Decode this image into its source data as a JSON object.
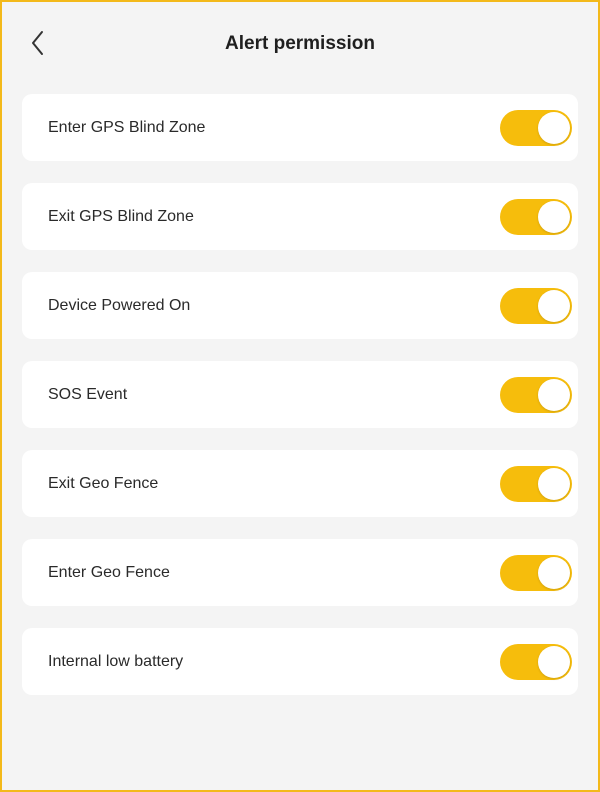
{
  "header": {
    "title": "Alert permission",
    "back_icon": "chevron-left-icon"
  },
  "colors": {
    "accent": "#f6bd0c",
    "frame_border": "#f3b91a",
    "background": "#f4f4f4",
    "card": "#ffffff"
  },
  "alerts": [
    {
      "label": "Enter GPS Blind Zone",
      "enabled": true
    },
    {
      "label": "Exit GPS Blind Zone",
      "enabled": true
    },
    {
      "label": "Device Powered On",
      "enabled": true
    },
    {
      "label": "SOS Event",
      "enabled": true
    },
    {
      "label": "Exit Geo Fence",
      "enabled": true
    },
    {
      "label": "Enter Geo Fence",
      "enabled": true
    },
    {
      "label": "Internal low battery",
      "enabled": true
    }
  ]
}
